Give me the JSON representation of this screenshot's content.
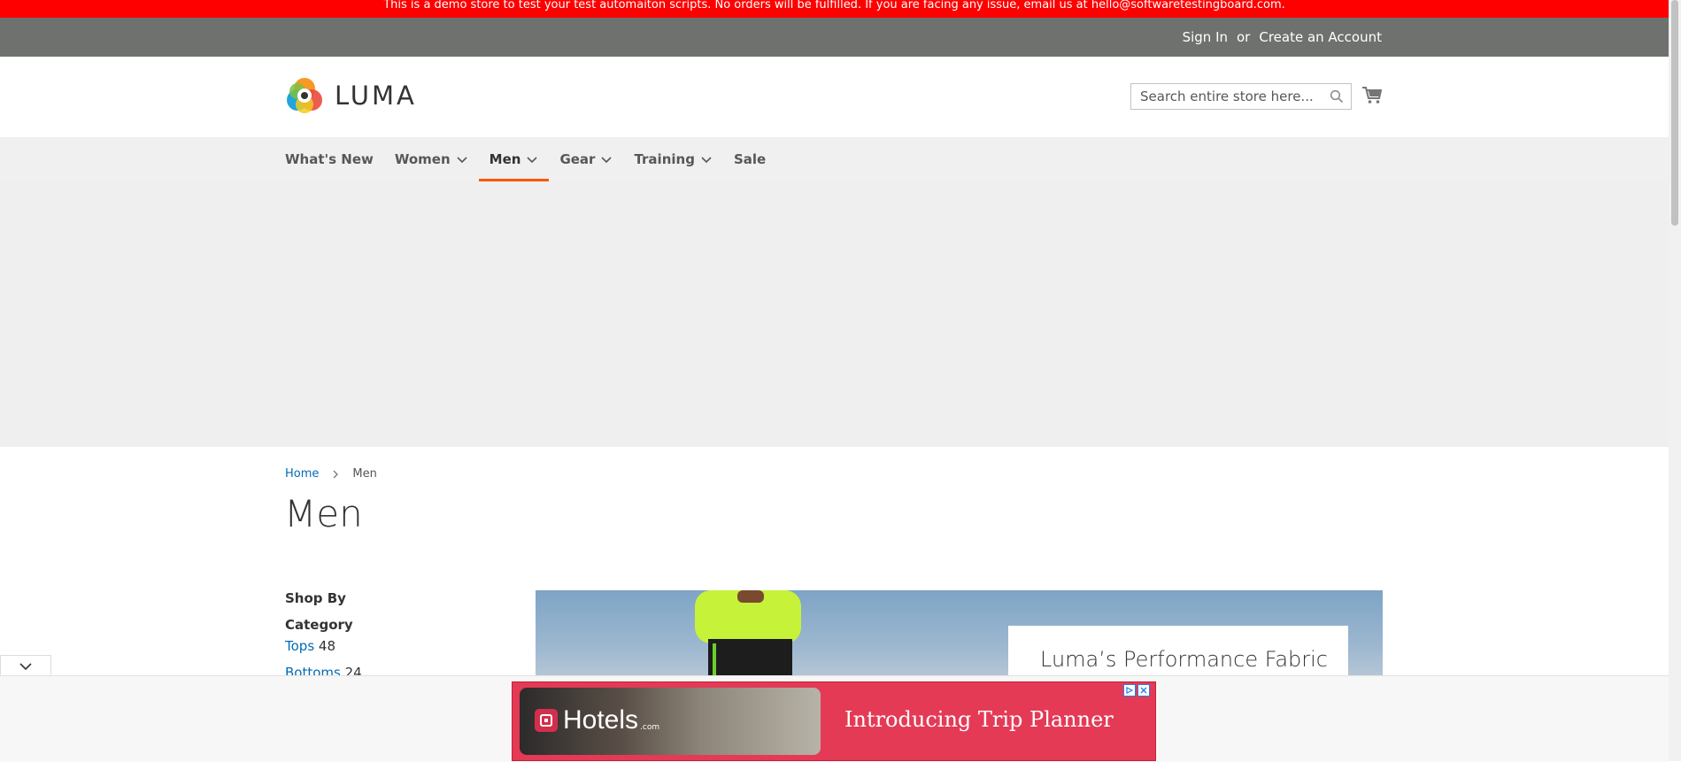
{
  "demo_notice": "This is a demo store to test your test automaiton scripts. No orders will be fulfilled. If you are facing any issue, email us at hello@softwaretestingboard.com.",
  "header_links": {
    "sign_in": "Sign In",
    "or": "or",
    "create_account": "Create an Account"
  },
  "logo": {
    "text": "LUMA"
  },
  "search": {
    "placeholder": "Search entire store here...",
    "value": ""
  },
  "nav": {
    "items": [
      "What's New",
      "Women",
      "Men",
      "Gear",
      "Training",
      "Sale"
    ],
    "active": "Men"
  },
  "breadcrumbs": {
    "home": "Home",
    "current": "Men"
  },
  "page_title": "Men",
  "sidebar": {
    "shop_by": "Shop By",
    "category_title": "Category",
    "filters": [
      {
        "label": "Tops",
        "count": "48"
      },
      {
        "label": "Bottoms",
        "count": "24"
      }
    ]
  },
  "promo": {
    "title": "Luma’s Performance Fabric"
  },
  "ad": {
    "brand": "Hotels",
    "brand_suffix": ".com",
    "headline": "Introducing Trip Planner"
  },
  "colors": {
    "demo_banner": "#ff0000",
    "topbar": "#6e716e",
    "nav_bg": "#f0f0f0",
    "active_underline": "#ff5501",
    "link": "#006bb4",
    "ad_bg": "#e43a55"
  }
}
